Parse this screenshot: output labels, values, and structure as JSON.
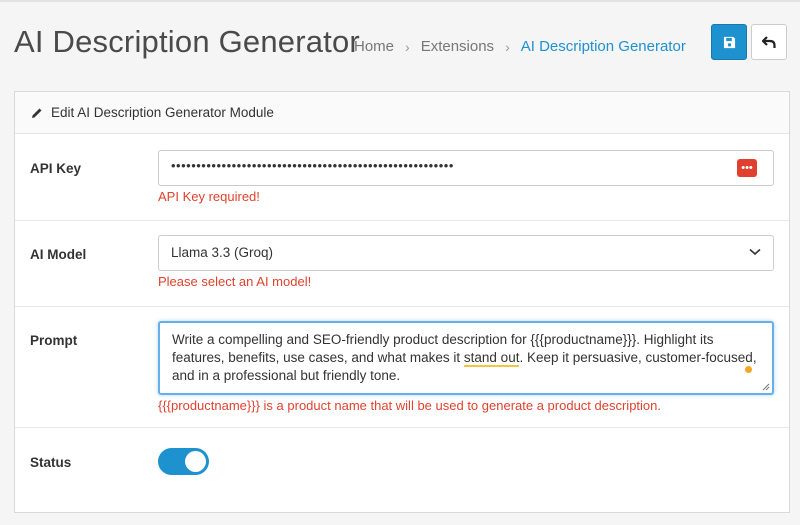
{
  "header": {
    "title": "AI Description Generator",
    "breadcrumb": [
      "Home",
      "Extensions",
      "AI Description Generator"
    ],
    "save_icon": "save-icon",
    "back_icon": "back-arrow-icon",
    "accent_color": "#1e91cf"
  },
  "panel": {
    "heading": "Edit AI Description Generator Module",
    "heading_icon": "pencil-icon"
  },
  "form": {
    "api_key": {
      "label": "API Key",
      "value": "••••••••••••••••••••••••••••••••••••••••••••••••••••••••",
      "error": "API Key required!",
      "error_color": "#e0422f"
    },
    "ai_model": {
      "label": "AI Model",
      "selected": "Llama 3.3 (Groq)",
      "error": "Please select an AI model!"
    },
    "prompt": {
      "label": "Prompt",
      "value_part1": "Write a compelling and SEO-friendly product description for {{{productname}}}. Highlight its features, benefits, use cases, and what makes it ",
      "value_highlight": "stand out",
      "value_part2": ". Keep it persuasive, customer-focused, and in a professional but friendly tone.",
      "help": "{{{productname}}} is a product name that will be used to generate a product description."
    },
    "status": {
      "label": "Status",
      "enabled": true
    }
  }
}
